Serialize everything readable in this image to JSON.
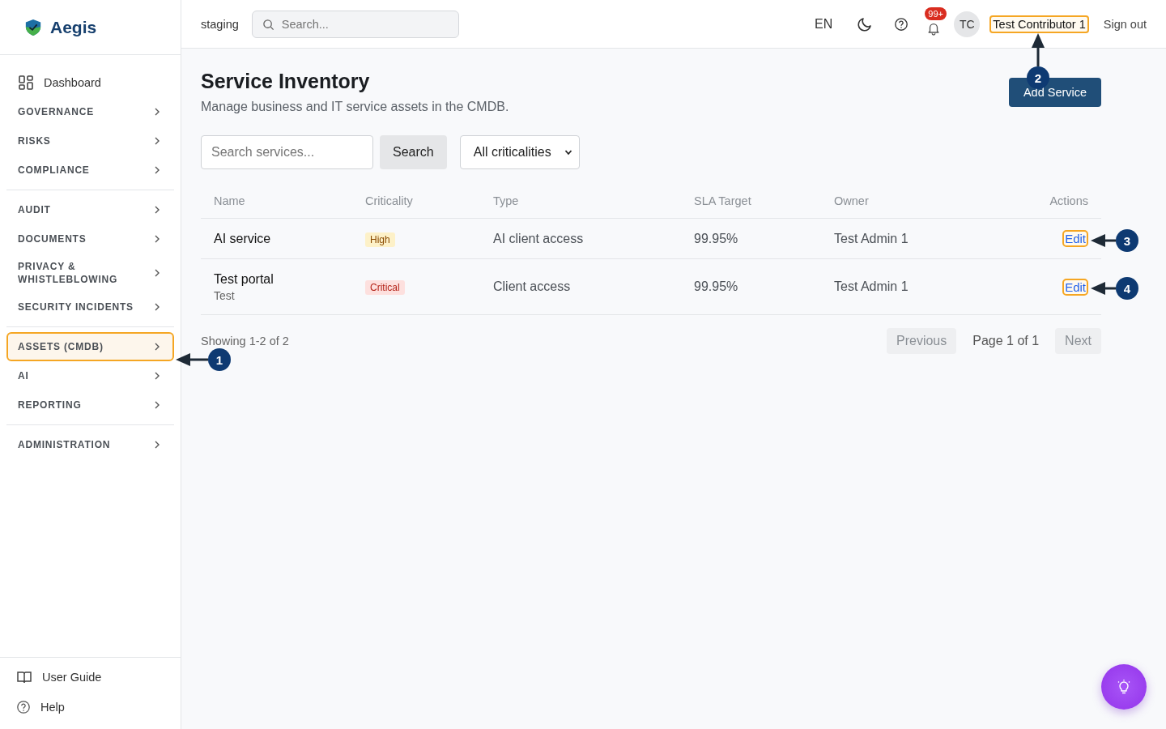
{
  "app": {
    "name": "Aegis"
  },
  "sidebar": {
    "sections": [
      [
        {
          "kind": "link",
          "label": "Dashboard",
          "selected": false
        },
        {
          "kind": "group",
          "label": "GOVERNANCE",
          "selected": false
        },
        {
          "kind": "group",
          "label": "RISKS",
          "selected": false
        },
        {
          "kind": "group",
          "label": "COMPLIANCE",
          "selected": false
        }
      ],
      [
        {
          "kind": "group",
          "label": "AUDIT",
          "selected": false
        },
        {
          "kind": "group",
          "label": "DOCUMENTS",
          "selected": false
        },
        {
          "kind": "group",
          "label": "PRIVACY & WHISTLEBLOWING",
          "selected": false
        },
        {
          "kind": "group",
          "label": "SECURITY INCIDENTS",
          "selected": false
        }
      ],
      [
        {
          "kind": "group",
          "label": "ASSETS (CMDB)",
          "selected": true
        },
        {
          "kind": "group",
          "label": "AI",
          "selected": false
        },
        {
          "kind": "group",
          "label": "REPORTING",
          "selected": false
        }
      ],
      [
        {
          "kind": "group",
          "label": "ADMINISTRATION",
          "selected": false
        }
      ]
    ],
    "footer": [
      {
        "kind": "guide",
        "label": "User Guide"
      },
      {
        "kind": "help",
        "label": "Help"
      }
    ]
  },
  "header": {
    "environment": "staging",
    "search": {
      "placeholder": "Search..."
    },
    "language": "EN",
    "notifications": "99+",
    "avatar": "TC",
    "user": {
      "label": "Test Contributor 1",
      "highlighted": true
    },
    "sign_out": "Sign out"
  },
  "page": {
    "title": "Service Inventory",
    "subtitle": "Manage business and IT service assets in the CMDB.",
    "add_button": "Add Service"
  },
  "filters": {
    "search": {
      "placeholder": "Search services..."
    },
    "search_button": "Search",
    "criticality": {
      "value": "All criticalities"
    }
  },
  "table": {
    "columns": [
      "Name",
      "Criticality",
      "Type",
      "SLA Target",
      "Owner",
      "Actions"
    ],
    "rows": [
      {
        "name": "AI service",
        "criticality": {
          "label": "High",
          "kind": "high"
        },
        "type": "AI client access",
        "sla": "99.95%",
        "owner": "Test Admin 1",
        "action": {
          "label": "Edit",
          "highlighted": true
        }
      },
      {
        "name": "Test portal",
        "description": "Test",
        "criticality": {
          "label": "Critical",
          "kind": "critical"
        },
        "type": "Client access",
        "sla": "99.95%",
        "owner": "Test Admin 1",
        "action": {
          "label": "Edit",
          "highlighted": true
        }
      }
    ]
  },
  "pagination": {
    "summary": "Showing 1-2 of 2",
    "previous": {
      "label": "Previous",
      "disabled": true
    },
    "page": "Page 1 of 1",
    "next": {
      "label": "Next",
      "disabled": true
    }
  },
  "annotations": [
    {
      "number": "1"
    },
    {
      "number": "2"
    },
    {
      "number": "3"
    },
    {
      "number": "4"
    }
  ]
}
